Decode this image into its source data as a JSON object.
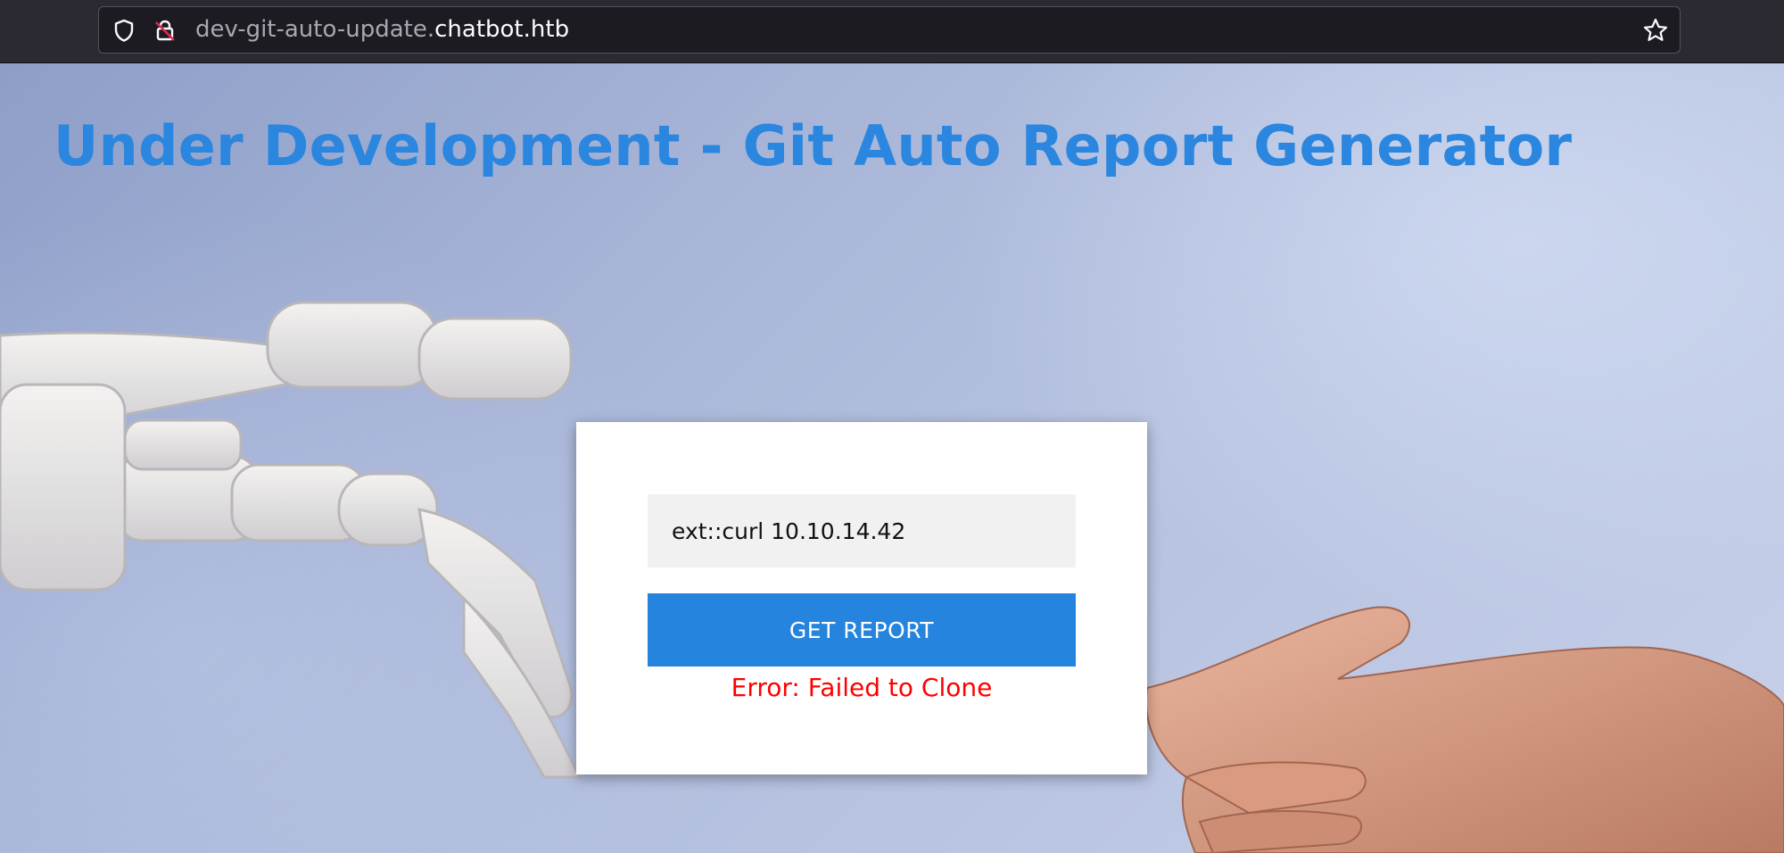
{
  "browser": {
    "url_subdomain": "dev-git-auto-update.",
    "url_domain": "chatbot.htb"
  },
  "page": {
    "title": "Under Development - Git Auto Report Generator"
  },
  "form": {
    "repo_value": "ext::curl 10.10.14.42",
    "button_label": "GET REPORT",
    "error_text": "Error: Failed to Clone"
  },
  "colors": {
    "title": "#2a86df",
    "button": "#2584dd",
    "error": "#ff0000"
  },
  "icons": {
    "shield": "shield-icon",
    "lock": "insecure-lock-icon",
    "bookmark": "star-icon"
  }
}
